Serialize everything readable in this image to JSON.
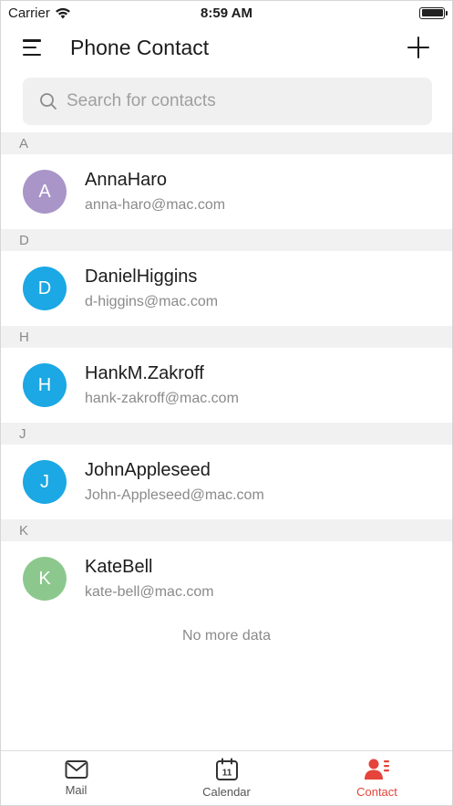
{
  "status_bar": {
    "carrier": "Carrier",
    "time": "8:59 AM"
  },
  "header": {
    "title": "Phone Contact"
  },
  "search": {
    "placeholder": "Search for contacts",
    "value": ""
  },
  "sections": [
    {
      "letter": "A",
      "contacts": [
        {
          "initial": "A",
          "name": "AnnaHaro",
          "email": "anna-haro@mac.com",
          "color": "#a995c8"
        }
      ]
    },
    {
      "letter": "D",
      "contacts": [
        {
          "initial": "D",
          "name": "DanielHiggins",
          "email": "d-higgins@mac.com",
          "color": "#1ba8e4"
        }
      ]
    },
    {
      "letter": "H",
      "contacts": [
        {
          "initial": "H",
          "name": "HankM.Zakroff",
          "email": "hank-zakroff@mac.com",
          "color": "#1ba8e4"
        }
      ]
    },
    {
      "letter": "J",
      "contacts": [
        {
          "initial": "J",
          "name": "JohnAppleseed",
          "email": "John-Appleseed@mac.com",
          "color": "#1ba8e4"
        }
      ]
    },
    {
      "letter": "K",
      "contacts": [
        {
          "initial": "K",
          "name": "KateBell",
          "email": "kate-bell@mac.com",
          "color": "#8cc88e"
        }
      ]
    }
  ],
  "list_footer": "No more data",
  "tab_bar": {
    "tabs": [
      {
        "label": "Mail",
        "icon": "mail-icon",
        "active": false
      },
      {
        "label": "Calendar",
        "icon": "calendar-icon",
        "active": false,
        "icon_text": "11"
      },
      {
        "label": "Contact",
        "icon": "contact-icon",
        "active": true
      }
    ],
    "accent": "#e5443a"
  }
}
